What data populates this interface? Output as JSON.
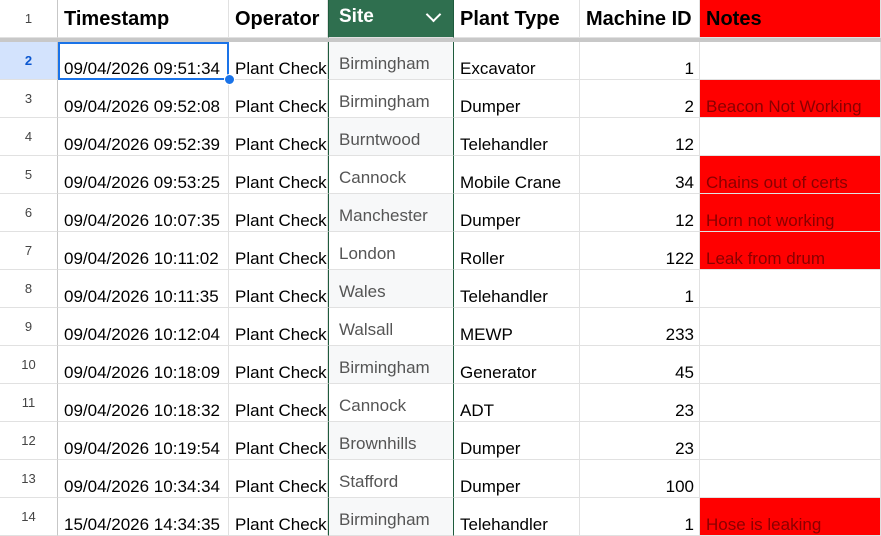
{
  "headers": {
    "header_row_number": "1",
    "timestamp": "Timestamp",
    "operator": "Operator",
    "site": "Site",
    "plant_type": "Plant Type",
    "machine_id": "Machine ID",
    "notes": "Notes"
  },
  "rows": [
    {
      "num": "2",
      "timestamp": "09/04/2026 09:51:34",
      "operator": "Plant Check",
      "site": "Birmingham",
      "plant_type": "Excavator",
      "machine_id": "1",
      "notes": ""
    },
    {
      "num": "3",
      "timestamp": "09/04/2026 09:52:08",
      "operator": "Plant Check",
      "site": "Birmingham",
      "plant_type": "Dumper",
      "machine_id": "2",
      "notes": "Beacon Not Working"
    },
    {
      "num": "4",
      "timestamp": "09/04/2026 09:52:39",
      "operator": "Plant Check",
      "site": "Burntwood",
      "plant_type": "Telehandler",
      "machine_id": "12",
      "notes": ""
    },
    {
      "num": "5",
      "timestamp": "09/04/2026 09:53:25",
      "operator": "Plant Check",
      "site": "Cannock",
      "plant_type": "Mobile Crane",
      "machine_id": "34",
      "notes": "Chains out of certs"
    },
    {
      "num": "6",
      "timestamp": "09/04/2026 10:07:35",
      "operator": "Plant Check",
      "site": "Manchester",
      "plant_type": "Dumper",
      "machine_id": "12",
      "notes": "Horn not working"
    },
    {
      "num": "7",
      "timestamp": "09/04/2026 10:11:02",
      "operator": "Plant Check",
      "site": "London",
      "plant_type": "Roller",
      "machine_id": "122",
      "notes": "Leak from drum"
    },
    {
      "num": "8",
      "timestamp": "09/04/2026 10:11:35",
      "operator": "Plant Check",
      "site": "Wales",
      "plant_type": "Telehandler",
      "machine_id": "1",
      "notes": ""
    },
    {
      "num": "9",
      "timestamp": "09/04/2026 10:12:04",
      "operator": "Plant Check",
      "site": "Walsall",
      "plant_type": "MEWP",
      "machine_id": "233",
      "notes": ""
    },
    {
      "num": "10",
      "timestamp": "09/04/2026 10:18:09",
      "operator": "Plant Check",
      "site": "Birmingham",
      "plant_type": "Generator",
      "machine_id": "45",
      "notes": ""
    },
    {
      "num": "11",
      "timestamp": "09/04/2026 10:18:32",
      "operator": "Plant Check",
      "site": "Cannock",
      "plant_type": "ADT",
      "machine_id": "23",
      "notes": ""
    },
    {
      "num": "12",
      "timestamp": "09/04/2026 10:19:54",
      "operator": "Plant Check",
      "site": "Brownhills",
      "plant_type": "Dumper",
      "machine_id": "23",
      "notes": ""
    },
    {
      "num": "13",
      "timestamp": "09/04/2026 10:34:34",
      "operator": "Plant Check",
      "site": "Stafford",
      "plant_type": "Dumper",
      "machine_id": "100",
      "notes": ""
    },
    {
      "num": "14",
      "timestamp": "15/04/2026 14:34:35",
      "operator": "Plant Check",
      "site": "Birmingham",
      "plant_type": "Telehandler",
      "machine_id": "1",
      "notes": "Hose is leaking"
    }
  ],
  "colors": {
    "site_header": "#2f6f4f",
    "note_highlight": "#ff0000",
    "selection": "#1a73e8"
  }
}
